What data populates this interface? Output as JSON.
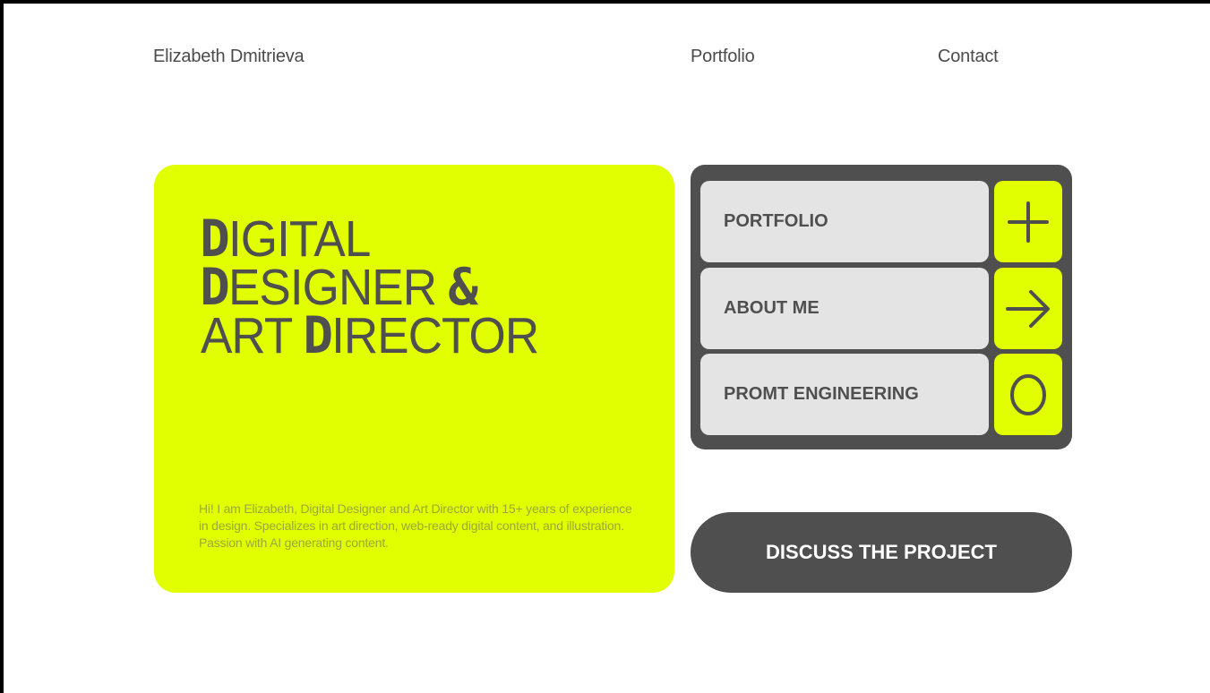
{
  "header": {
    "name": "Elizabeth Dmitrieva",
    "nav": {
      "portfolio": "Portfolio",
      "contact": "Contact"
    }
  },
  "hero": {
    "headline": {
      "line1_initial": "D",
      "line1_rest": "IGITAL",
      "line2_initial": "D",
      "line2_rest": "ESIGNER ",
      "line2_amp": "&",
      "line3_start": "ART ",
      "line3_initial": "D",
      "line3_rest": "IRECTOR"
    },
    "intro": "Hi! I am Elizabeth, Digital Designer and Art Director with 15+ years of experience in design. Specializes in art direction, web-ready digital content, and illustration. Passion with AI generating content."
  },
  "menu": {
    "items": [
      {
        "label": "PORTFOLIO",
        "icon": "plus-icon"
      },
      {
        "label": "ABOUT ME",
        "icon": "arrow-right-icon"
      },
      {
        "label": "PROMT ENGINEERING",
        "icon": "circle-icon"
      }
    ]
  },
  "cta": {
    "label": "DISCUSS THE PROJECT"
  },
  "colors": {
    "accent": "#e2ff00",
    "dark": "#4f4f4f",
    "light_gray": "#e4e4e4",
    "background": "#ffffff"
  }
}
